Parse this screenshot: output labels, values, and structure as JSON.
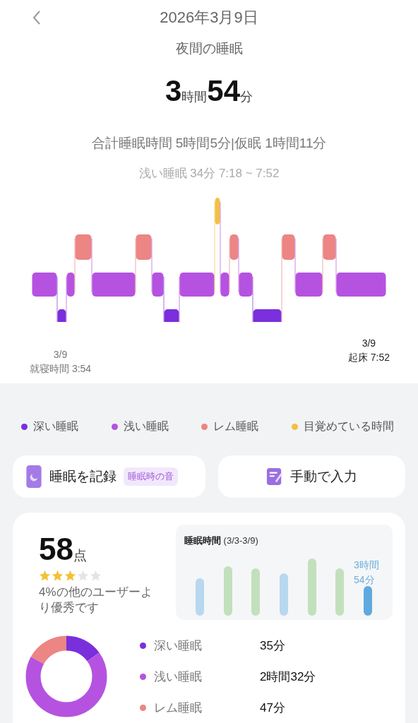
{
  "header": {
    "title": "2026年3月9日"
  },
  "summary": {
    "label": "夜間の睡眠",
    "hours": "3",
    "hours_unit": "時間",
    "minutes": "54",
    "minutes_unit": "分",
    "total": "合計睡眠時間 5時間5分|仮眠 1時間11分",
    "selected_segment": "浅い睡眠 34分 7:18 ~ 7:52"
  },
  "hypnogram": {
    "start_date": "3/9",
    "start_label": "就寝時間 3:54",
    "end_date": "3/9",
    "end_label": "起床 7:52"
  },
  "legend": [
    {
      "label": "深い睡眠",
      "color": "#7a2fdc"
    },
    {
      "label": "浅い睡眠",
      "color": "#b553e0"
    },
    {
      "label": "レム睡眠",
      "color": "#ec8584"
    },
    {
      "label": "目覚めている時間",
      "color": "#f3c041"
    }
  ],
  "actions": [
    {
      "kind": "record",
      "label": "睡眠を記録",
      "badge": "睡眠時の音"
    },
    {
      "kind": "manual",
      "label": "手動で入力"
    }
  ],
  "score": {
    "value": "58",
    "unit": "点",
    "stars": 3,
    "comparison": "4%の他のユーザーより優秀です"
  },
  "weekly": {
    "title": "**睡眠時間** (3/3-3/9)",
    "latest_label": "3時間\n54分"
  },
  "breakdown": [
    {
      "label": "深い睡眠",
      "value": "35分",
      "color": "#7a2fdc"
    },
    {
      "label": "浅い睡眠",
      "value": "2時間32分",
      "color": "#b553e0"
    },
    {
      "label": "レム睡眠",
      "value": "47分",
      "color": "#ec8584"
    }
  ]
}
